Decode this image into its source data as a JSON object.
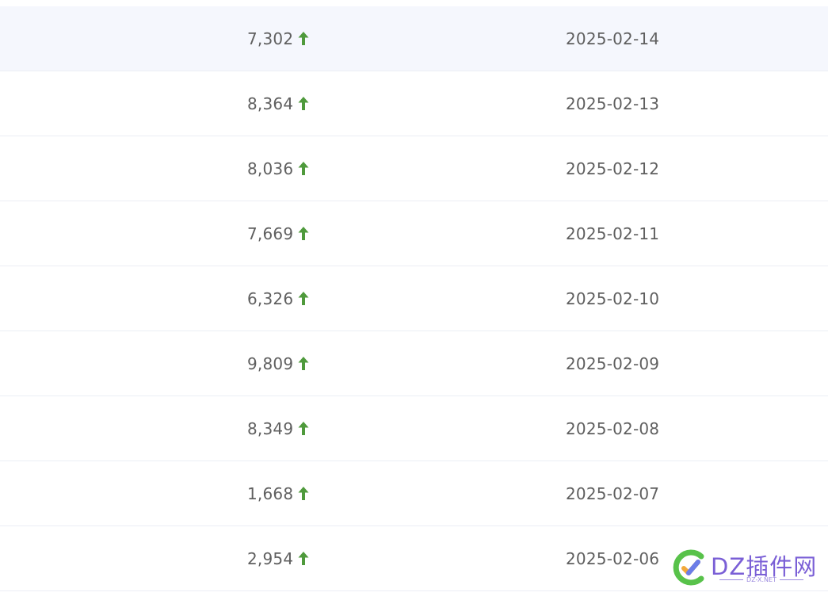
{
  "rows": [
    {
      "count": "7,302",
      "date": "2025-02-14",
      "highlighted": true
    },
    {
      "count": "8,364",
      "date": "2025-02-13"
    },
    {
      "count": "8,036",
      "date": "2025-02-12"
    },
    {
      "count": "7,669",
      "date": "2025-02-11"
    },
    {
      "count": "6,326",
      "date": "2025-02-10"
    },
    {
      "count": "9,809",
      "date": "2025-02-09"
    },
    {
      "count": "8,349",
      "date": "2025-02-08"
    },
    {
      "count": "1,668",
      "date": "2025-02-07"
    },
    {
      "count": "2,954",
      "date": "2025-02-06"
    }
  ],
  "trend_icon": "arrow-up-icon",
  "colors": {
    "trend_up": "#4f9a3c",
    "row_highlight": "#f5f7fd",
    "text": "#5f5f5f",
    "divider": "#ebeef5"
  },
  "watermark": {
    "brand": "DZ插件网",
    "sub": "DZ-X.NET"
  }
}
